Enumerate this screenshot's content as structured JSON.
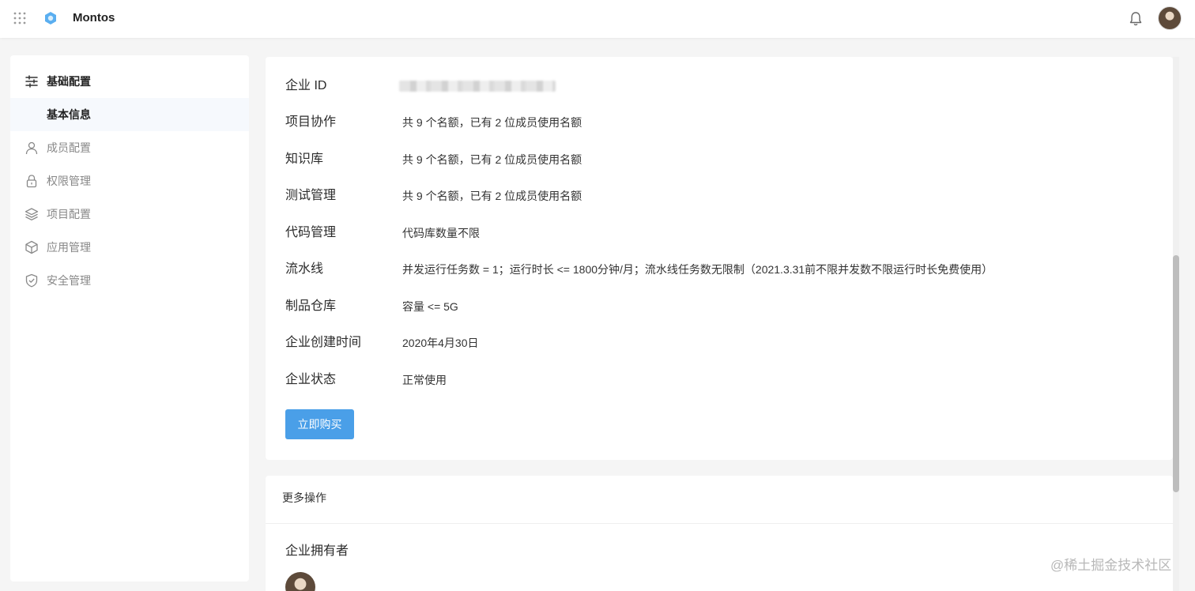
{
  "header": {
    "brand_name": "Montos",
    "apps_icon": "grid-apps-icon",
    "logo_icon": "montos-logo-icon",
    "bell_icon": "bell-icon",
    "accent_color": "#4a9fe8"
  },
  "sidebar": {
    "items": [
      {
        "label": "基础配置",
        "icon": "sliders-icon",
        "state": "section"
      },
      {
        "label": "基本信息",
        "icon": "",
        "state": "active"
      },
      {
        "label": "成员配置",
        "icon": "user-icon",
        "state": "normal"
      },
      {
        "label": "权限管理",
        "icon": "lock-icon",
        "state": "normal"
      },
      {
        "label": "项目配置",
        "icon": "layers-icon",
        "state": "normal"
      },
      {
        "label": "应用管理",
        "icon": "cube-icon",
        "state": "normal"
      },
      {
        "label": "安全管理",
        "icon": "shield-check-icon",
        "state": "normal"
      }
    ]
  },
  "info": {
    "rows": [
      {
        "key": "企业 ID",
        "value": ""
      },
      {
        "key": "项目协作",
        "value": "共 9 个名额，已有 2 位成员使用名额"
      },
      {
        "key": "知识库",
        "value": "共 9 个名额，已有 2 位成员使用名额"
      },
      {
        "key": "测试管理",
        "value": "共 9 个名额，已有 2 位成员使用名额"
      },
      {
        "key": "代码管理",
        "value": "代码库数量不限"
      },
      {
        "key": "流水线",
        "value": "并发运行任务数 = 1；运行时长 <= 1800分钟/月；流水线任务数无限制（2021.3.31前不限并发数不限运行时长免费使用）"
      },
      {
        "key": "制品仓库",
        "value": "容量 <= 5G"
      },
      {
        "key": "企业创建时间",
        "value": "2020年4月30日"
      },
      {
        "key": "企业状态",
        "value": "正常使用"
      }
    ],
    "buy_button": "立即购买"
  },
  "more": {
    "title": "更多操作",
    "owner_title": "企业拥有者"
  },
  "watermark": "@稀土掘金技术社区"
}
